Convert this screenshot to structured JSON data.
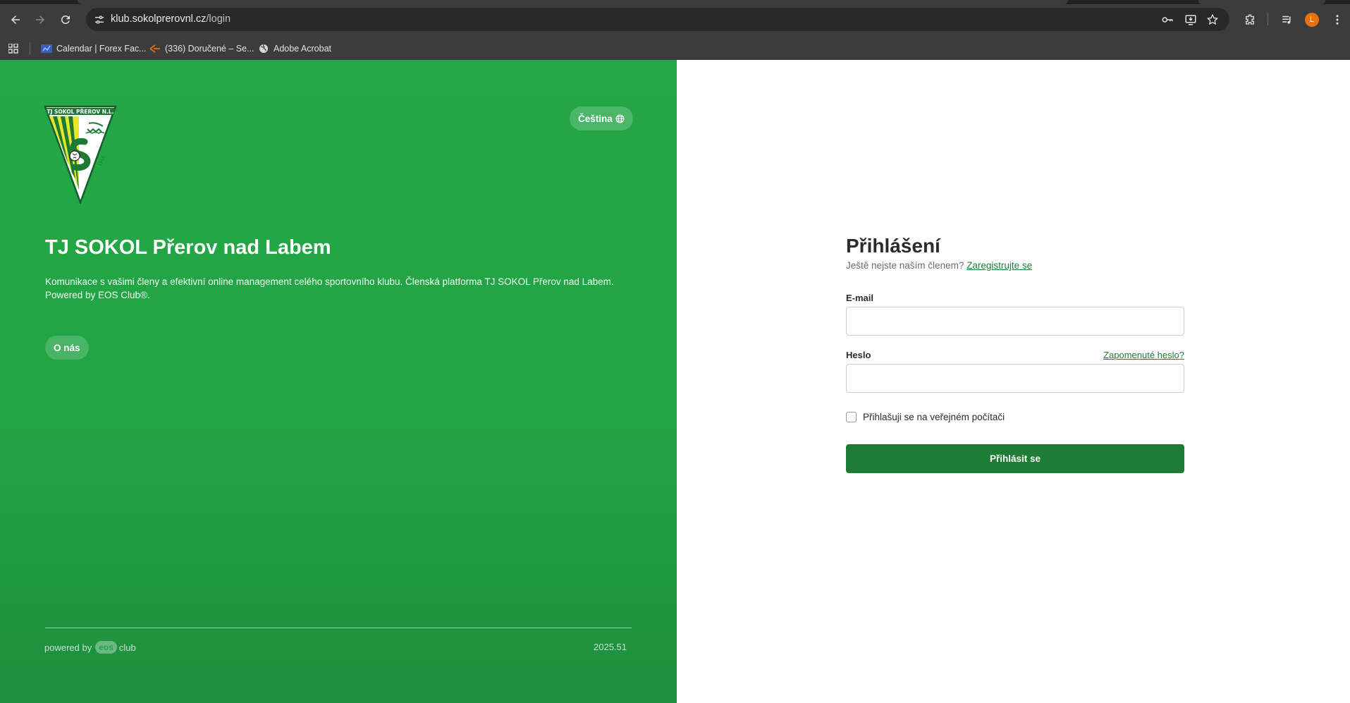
{
  "browser": {
    "url_host": "klub.sokolprerovnl.cz",
    "url_path": "/login",
    "profile_initial": "L",
    "bookmarks": [
      {
        "label": "Calendar | Forex Fac...",
        "icon": "forex-factory-icon"
      },
      {
        "label": "(336) Doručené – Se...",
        "icon": "mail-icon"
      },
      {
        "label": "Adobe Acrobat",
        "icon": "globe-icon"
      }
    ],
    "colors": {
      "frame": "#3c3c3c",
      "omnibox": "#282828",
      "avatar": "#e8710a"
    }
  },
  "hero": {
    "language_label": "Čeština",
    "club_name": "TJ SOKOL Přerov nad Labem",
    "description": "Komunikace s vašimi členy a efektivní online management celého sportovního klubu. Členská platforma TJ SOKOL Přerov nad Labem. Powered by EOS Club®.",
    "about_label": "O nás",
    "powered_by": "powered by",
    "eos_logo_text": "eos",
    "club_word": "club",
    "version": "2025.51",
    "logo_text": "TJ SOKOL PŘEROV N.L.",
    "colors": {
      "green": "#24a746",
      "green_dark": "#1e8e3e"
    }
  },
  "login": {
    "title": "Přihlášení",
    "not_member_text": "Ještě nejste naším členem?",
    "register_link": "Zaregistrujte se",
    "email_label": "E-mail",
    "email_value": "",
    "password_label": "Heslo",
    "password_value": "",
    "forgot_link": "Zapomenuté heslo?",
    "public_computer_label": "Přihlašuji se na veřejném počítači",
    "public_computer_checked": false,
    "submit_label": "Přihlásit se",
    "colors": {
      "button": "#1e7d34",
      "link": "#1e7d34"
    }
  }
}
